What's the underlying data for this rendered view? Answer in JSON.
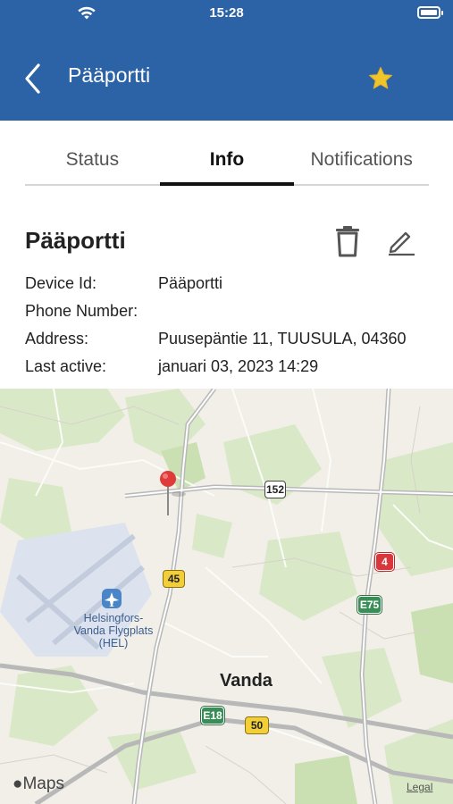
{
  "status_bar": {
    "time": "15:28"
  },
  "nav": {
    "title": "Pääportti",
    "back_icon": "chevron-left-icon",
    "favorite_icon": "star-icon",
    "favorite_color": "#f0c42b"
  },
  "tabs": [
    {
      "label": "Status",
      "active": false
    },
    {
      "label": "Info",
      "active": true
    },
    {
      "label": "Notifications",
      "active": false
    }
  ],
  "device": {
    "name": "Pääportti",
    "fields": [
      {
        "label": "Device Id:",
        "value": "Pääportti"
      },
      {
        "label": "Phone Number:",
        "value": ""
      },
      {
        "label": "Address:",
        "value": "Puusepäntie 11, TUUSULA, 04360"
      },
      {
        "label": "Last active:",
        "value": "januari 03, 2023 14:29"
      }
    ]
  },
  "map": {
    "airport_label_1": "Helsingfors-",
    "airport_label_2": "Vanda Flygplats",
    "airport_label_3": "(HEL)",
    "city_label": "Vanda",
    "shields": {
      "r152": "152",
      "r45": "45",
      "r4": "4",
      "e75": "E75",
      "e18": "E18",
      "r50": "50"
    },
    "attribution": "Maps",
    "legal": "Legal"
  },
  "colors": {
    "header": "#2c63a6",
    "pin": "#e03b3b"
  }
}
